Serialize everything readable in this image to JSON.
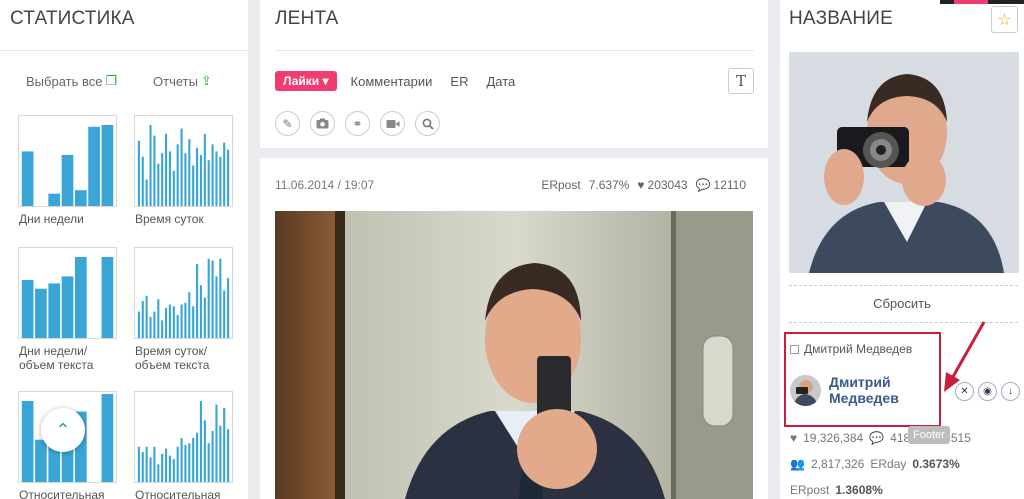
{
  "stats": {
    "title": "СТАТИСТИКА",
    "select_all": "Выбрать все",
    "reports": "Отчеты",
    "charts": [
      {
        "label": "Дни недели"
      },
      {
        "label": "Время суток"
      },
      {
        "label": "Дни недели/\nобъем текста"
      },
      {
        "label": "Время суток/\nобъем текста"
      },
      {
        "label": "Относительная"
      },
      {
        "label": "Относительная"
      }
    ],
    "chart_color": "#3aa6d8"
  },
  "feed": {
    "title": "ЛЕНТА",
    "filters": {
      "likes": "Лайки",
      "comments": "Комментарии",
      "er": "ER",
      "date": "Дата"
    },
    "text_button": "T",
    "icons": [
      "pencil-icon",
      "camera-icon",
      "link-icon",
      "video-icon",
      "search-icon"
    ],
    "post": {
      "date": "11.06.2014 / 19:07",
      "er_label": "ERpost",
      "er_value": "7.637%",
      "likes": "203043",
      "comments": "12110"
    }
  },
  "profile": {
    "title": "НАЗВАНИЕ",
    "reset": "Сбросить",
    "selected_label": "Дмитрий Медведев",
    "name": "Дмитрий Медведев",
    "likes": "19,326,384",
    "comments": "418,10",
    "comments_tail": "515",
    "tooltip": "Footer",
    "followers": "2,817,326",
    "erday_label": "ERday",
    "erday_value": "0.3673%",
    "erpost_label": "ERpost",
    "erpost_value": "1.3608%"
  },
  "colors": {
    "accent": "#f03c6e",
    "link": "#3b5a8a",
    "highlight": "#c81e3c"
  }
}
